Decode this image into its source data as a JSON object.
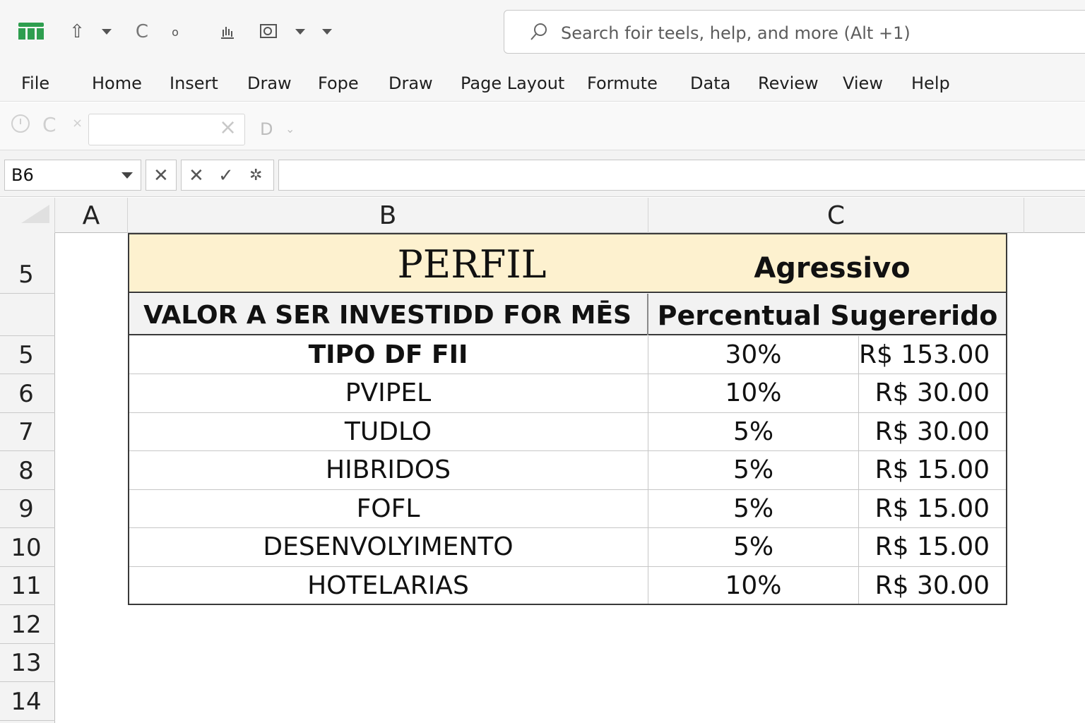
{
  "search": {
    "placeholder": "Search foir teels, help, and more (Alt +1)"
  },
  "tabs": [
    "File",
    "Home",
    "Insert",
    "Draw",
    "Fope",
    "Draw",
    "Page Layout",
    "Formute",
    "Data",
    "Review",
    "View",
    "Help"
  ],
  "ribbon": {
    "dropdown_label": "D"
  },
  "formula_bar": {
    "name_box": "B6",
    "formula": ""
  },
  "columns": [
    "A",
    "B",
    "C"
  ],
  "row_headers": [
    "5",
    "5",
    "6",
    "7",
    "8",
    "9",
    "10",
    "11",
    "12",
    "13",
    "14"
  ],
  "table": {
    "title_left": "PERFIL",
    "title_right": "Agressivo",
    "header_left": "VALOR A SER INVESTIDD FOR MĒS",
    "header_right": "Percentual Sugererido",
    "rows": [
      {
        "type": "TIPO DF FII",
        "percent": "30%",
        "value": "R$ 153.00"
      },
      {
        "type": "PVIPEL",
        "percent": "10%",
        "value": "R$ 30.00"
      },
      {
        "type": "TUDLO",
        "percent": "5%",
        "value": "R$ 30.00"
      },
      {
        "type": "HIBRIDOS",
        "percent": "5%",
        "value": "R$ 15.00"
      },
      {
        "type": "FOFL",
        "percent": "5%",
        "value": "R$ 15.00"
      },
      {
        "type": "DESENVOLYIMENTO",
        "percent": "5%",
        "value": "R$ 15.00"
      },
      {
        "type": "HOTELARIAS",
        "percent": "10%",
        "value": "R$ 30.00"
      }
    ]
  },
  "colors": {
    "title_fill": "#fdf1cf",
    "header_fill": "#f2f2f2",
    "app_icon": "#2e9e4f"
  },
  "icons": [
    "sheets-app-icon",
    "upload-icon",
    "redo-icon",
    "touch-icon",
    "shape-icon",
    "search-icon",
    "cancel-icon",
    "confirm-icon",
    "function-icon"
  ]
}
